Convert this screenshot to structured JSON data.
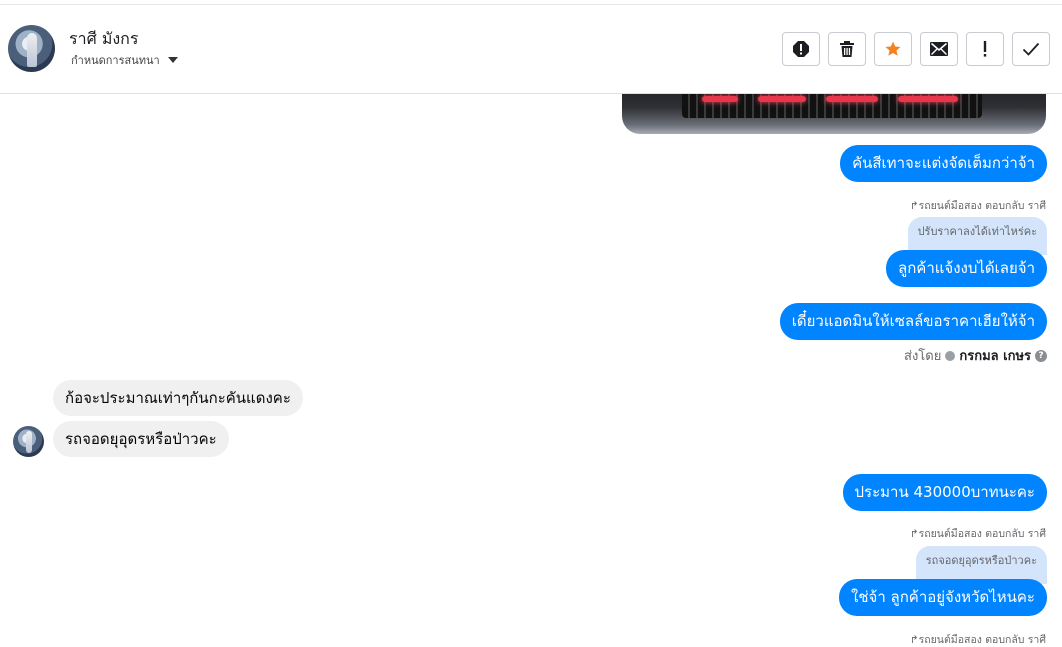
{
  "header": {
    "contact_name": "ราศี มังกร",
    "assign_label": "กำหนดการสนทนา",
    "actions": [
      {
        "icon": "spam-icon"
      },
      {
        "icon": "trash-icon"
      },
      {
        "icon": "star-icon",
        "color": "#f5821f"
      },
      {
        "icon": "mail-icon"
      },
      {
        "icon": "exclamation-icon"
      },
      {
        "icon": "check-icon"
      }
    ]
  },
  "messages": {
    "m1": {
      "text": "คันสีเทาจะแต่งจัดเต็มกว่าจ้า"
    },
    "r1": {
      "text": "รถยนต์มือสอง ตอบกลับ ราศี"
    },
    "q1": {
      "text": "ปรับราคาลงได้เท่าไหร่คะ"
    },
    "m2": {
      "text": "ลูกค้าแจ้งงบได้เลยจ้า"
    },
    "m3": {
      "text": "เดี๋ยวแอดมินให้เซลล์ขอราคาเฮียให้จ้า"
    },
    "sent_by": {
      "prefix": "ส่งโดย",
      "name": "กรกมล เกษร"
    },
    "in1": {
      "text": "ก้อจะประมาณเท่าๆกันกะคันแดงคะ"
    },
    "in2": {
      "text": "รถจอดยุอุดรหรือป่าวคะ"
    },
    "m4": {
      "text": "ประมาน 430000บาทนะคะ"
    },
    "r2": {
      "text": "รถยนต์มือสอง ตอบกลับ ราศี"
    },
    "q2": {
      "text": "รถจอดยุอุดรหรือป่าวคะ"
    },
    "m5": {
      "text": "ใช่จ้า ลูกค้าอยู่จังหวัดไหนคะ"
    },
    "r3": {
      "text": "รถยนต์มือสอง ตอบกลับ ราศี"
    }
  },
  "colors": {
    "outgoing_bubble": "#0084ff",
    "incoming_bubble": "#f0f0f0",
    "quote_bubble": "#d3e4fb",
    "star": "#f5821f"
  }
}
